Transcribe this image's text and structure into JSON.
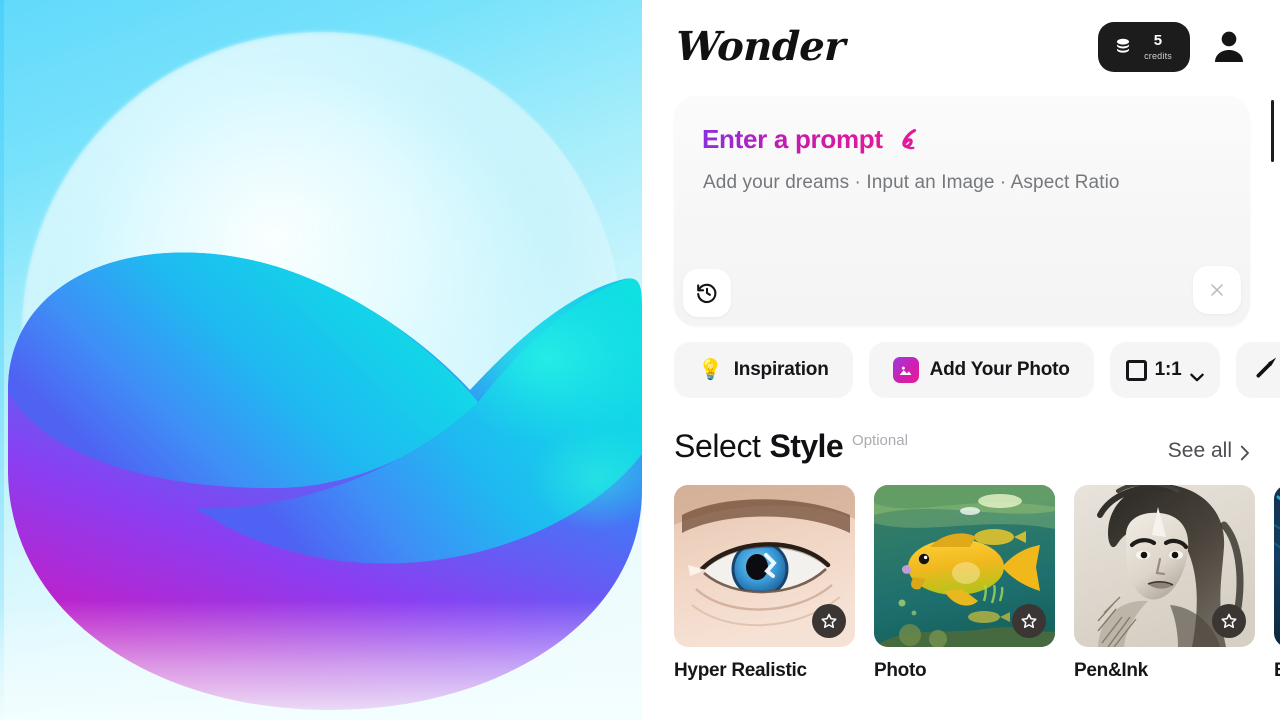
{
  "splash": {
    "alt": "Wonder app logo mark — gradient butterfly/heart shape on cyan sky background",
    "colors": {
      "bg_top": "#62d9fb",
      "bg_bottom": "#f4fdff",
      "magenta": "#d41bb4",
      "purple": "#6b47f0",
      "blue": "#2f7ef5",
      "cyan": "#16d6e8"
    }
  },
  "header": {
    "logo": "Wonder",
    "credits": {
      "icon": "coins-icon",
      "amount": "5",
      "label": "credits"
    },
    "avatar": {
      "icon": "user-avatar-icon"
    }
  },
  "prompt": {
    "title": "Enter a prompt",
    "title_icon": "pen-marker-icon",
    "subtitle": "Add your dreams · Input an Image · Aspect Ratio",
    "placeholder": "Add your dreams · Input an Image · Aspect Ratio",
    "value": "",
    "history_icon": "history-icon",
    "close_icon": "close-icon",
    "accent_from": "#8b2fe0",
    "accent_to": "#e2199a"
  },
  "chips": [
    {
      "label": "Inspiration",
      "icon": "lightbulb-icon",
      "name": "inspiration-chip"
    },
    {
      "label": "Add Your Photo",
      "icon": "image-gradient-icon",
      "name": "add-your-photo-chip"
    },
    {
      "label": "1:1",
      "icon": "square-ratio-icon",
      "name": "aspect-ratio-chip",
      "caret": "chevron-down-icon"
    },
    {
      "label": "",
      "icon": "magic-wand-icon",
      "name": "tools-chip"
    }
  ],
  "section": {
    "title_light": "Select",
    "title_bold": "Style",
    "optional": "Optional",
    "see_all": "See all",
    "see_all_icon": "chevron-right-icon"
  },
  "styles": [
    {
      "label": "Hyper Realistic",
      "art": "eye",
      "fav_icon": "star-icon"
    },
    {
      "label": "Photo",
      "art": "fish",
      "fav_icon": "star-icon"
    },
    {
      "label": "Pen&Ink",
      "art": "warrior",
      "fav_icon": "star-icon"
    },
    {
      "label": "E",
      "art": "epic",
      "fav_icon": "star-icon"
    }
  ]
}
